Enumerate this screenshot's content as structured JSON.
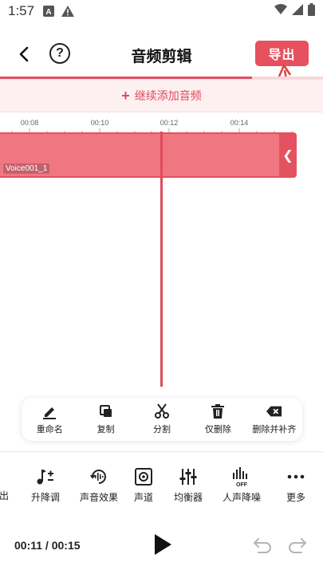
{
  "status": {
    "time": "1:57"
  },
  "header": {
    "title": "音频剪辑",
    "export_label": "导出"
  },
  "add_audio": {
    "plus": "+",
    "label": "继续添加音频"
  },
  "ruler": {
    "ticks": [
      "00:08",
      "00:10",
      "00:12",
      "00:14"
    ]
  },
  "clip": {
    "name": "Voice001_1",
    "handle": "❮"
  },
  "clip_tools": [
    {
      "label": "重命名",
      "icon": "pencil-icon"
    },
    {
      "label": "复制",
      "icon": "copy-icon"
    },
    {
      "label": "分割",
      "icon": "scissors-icon"
    },
    {
      "label": "仅删除",
      "icon": "trash-icon"
    },
    {
      "label": "删除并补齐",
      "icon": "backspace-icon"
    }
  ],
  "bottom_tools": [
    {
      "label": "出",
      "icon": ""
    },
    {
      "label": "升降调",
      "icon": "pitch-icon"
    },
    {
      "label": "声音效果",
      "icon": "sound-effect-icon"
    },
    {
      "label": "声道",
      "icon": "channel-icon"
    },
    {
      "label": "均衡器",
      "icon": "equalizer-icon"
    },
    {
      "label": "人声降噪",
      "icon": "denoise-icon"
    },
    {
      "label": "更多",
      "icon": "more-icon"
    }
  ],
  "playback": {
    "time": "00:11 / 00:15"
  },
  "colors": {
    "accent": "#e6505f",
    "clip": "#f07782"
  }
}
